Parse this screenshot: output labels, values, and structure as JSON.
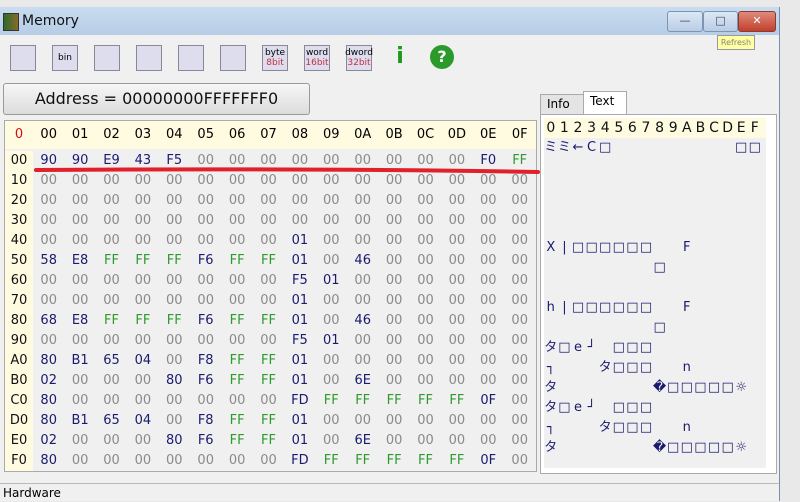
{
  "window": {
    "title": "Memory",
    "minimize": "—",
    "maximize": "□",
    "close": "✕",
    "tooltip": "Refresh"
  },
  "toolbar": [
    {
      "name": "save-icon",
      "label": ""
    },
    {
      "name": "save-bin-icon",
      "label": "bin"
    },
    {
      "name": "load-icon",
      "label": ""
    },
    {
      "name": "load-alt-icon",
      "label": ""
    },
    {
      "name": "find-binoculars-icon",
      "label": ""
    },
    {
      "name": "windows-icon",
      "label": ""
    },
    {
      "name": "byte-8bit-icon",
      "label": "byte",
      "sub": "8bit"
    },
    {
      "name": "word-16bit-icon",
      "label": "word",
      "sub": "16bit"
    },
    {
      "name": "dword-32bit-icon",
      "label": "dword",
      "sub": "32bit"
    },
    {
      "name": "info-icon",
      "label": "i"
    },
    {
      "name": "help-icon",
      "label": "?"
    }
  ],
  "address_button": "Address = 00000000FFFFFFF0",
  "hex": {
    "corner": "0",
    "columns": [
      "00",
      "01",
      "02",
      "03",
      "04",
      "05",
      "06",
      "07",
      "08",
      "09",
      "0A",
      "0B",
      "0C",
      "0D",
      "0E",
      "0F"
    ],
    "rows": [
      {
        "addr": "00",
        "bytes": [
          "90",
          "90",
          "E9",
          "43",
          "F5",
          "00",
          "00",
          "00",
          "00",
          "00",
          "00",
          "00",
          "00",
          "00",
          "F0",
          "FF"
        ]
      },
      {
        "addr": "10",
        "bytes": [
          "00",
          "00",
          "00",
          "00",
          "00",
          "00",
          "00",
          "00",
          "00",
          "00",
          "00",
          "00",
          "00",
          "00",
          "00",
          "00"
        ]
      },
      {
        "addr": "20",
        "bytes": [
          "00",
          "00",
          "00",
          "00",
          "00",
          "00",
          "00",
          "00",
          "00",
          "00",
          "00",
          "00",
          "00",
          "00",
          "00",
          "00"
        ]
      },
      {
        "addr": "30",
        "bytes": [
          "00",
          "00",
          "00",
          "00",
          "00",
          "00",
          "00",
          "00",
          "00",
          "00",
          "00",
          "00",
          "00",
          "00",
          "00",
          "00"
        ]
      },
      {
        "addr": "40",
        "bytes": [
          "00",
          "00",
          "00",
          "00",
          "00",
          "00",
          "00",
          "00",
          "01",
          "00",
          "00",
          "00",
          "00",
          "00",
          "00",
          "00"
        ]
      },
      {
        "addr": "50",
        "bytes": [
          "58",
          "E8",
          "FF",
          "FF",
          "FF",
          "F6",
          "FF",
          "FF",
          "01",
          "00",
          "46",
          "00",
          "00",
          "00",
          "00",
          "00"
        ]
      },
      {
        "addr": "60",
        "bytes": [
          "00",
          "00",
          "00",
          "00",
          "00",
          "00",
          "00",
          "00",
          "F5",
          "01",
          "00",
          "00",
          "00",
          "00",
          "00",
          "00"
        ]
      },
      {
        "addr": "70",
        "bytes": [
          "00",
          "00",
          "00",
          "00",
          "00",
          "00",
          "00",
          "00",
          "01",
          "00",
          "00",
          "00",
          "00",
          "00",
          "00",
          "00"
        ]
      },
      {
        "addr": "80",
        "bytes": [
          "68",
          "E8",
          "FF",
          "FF",
          "FF",
          "F6",
          "FF",
          "FF",
          "01",
          "00",
          "46",
          "00",
          "00",
          "00",
          "00",
          "00"
        ]
      },
      {
        "addr": "90",
        "bytes": [
          "00",
          "00",
          "00",
          "00",
          "00",
          "00",
          "00",
          "00",
          "F5",
          "01",
          "00",
          "00",
          "00",
          "00",
          "00",
          "00"
        ]
      },
      {
        "addr": "A0",
        "bytes": [
          "80",
          "B1",
          "65",
          "04",
          "00",
          "F8",
          "FF",
          "FF",
          "01",
          "00",
          "00",
          "00",
          "00",
          "00",
          "00",
          "00"
        ]
      },
      {
        "addr": "B0",
        "bytes": [
          "02",
          "00",
          "00",
          "00",
          "80",
          "F6",
          "FF",
          "FF",
          "01",
          "00",
          "6E",
          "00",
          "00",
          "00",
          "00",
          "00"
        ]
      },
      {
        "addr": "C0",
        "bytes": [
          "80",
          "00",
          "00",
          "00",
          "00",
          "00",
          "00",
          "00",
          "FD",
          "FF",
          "FF",
          "FF",
          "FF",
          "FF",
          "0F",
          "00"
        ]
      },
      {
        "addr": "D0",
        "bytes": [
          "80",
          "B1",
          "65",
          "04",
          "00",
          "F8",
          "FF",
          "FF",
          "01",
          "00",
          "00",
          "00",
          "00",
          "00",
          "00",
          "00"
        ]
      },
      {
        "addr": "E0",
        "bytes": [
          "02",
          "00",
          "00",
          "00",
          "80",
          "F6",
          "FF",
          "FF",
          "01",
          "00",
          "6E",
          "00",
          "00",
          "00",
          "00",
          "00"
        ]
      },
      {
        "addr": "F0",
        "bytes": [
          "80",
          "00",
          "00",
          "00",
          "00",
          "00",
          "00",
          "00",
          "FD",
          "FF",
          "FF",
          "FF",
          "FF",
          "FF",
          "0F",
          "00"
        ]
      }
    ]
  },
  "colors": {
    "zero": "#8a8a8a",
    "ff": "#2e9a2e",
    "value": "#1a1a6e",
    "corner": "#d01010",
    "annotation": "#e0202a"
  },
  "tabs": [
    {
      "label": "Info"
    },
    {
      "label": "Text"
    }
  ],
  "text_panel": {
    "header": [
      "0",
      "1",
      "2",
      "3",
      "4",
      "5",
      "6",
      "7",
      "8",
      "9",
      "A",
      "B",
      "C",
      "D",
      "E",
      "F"
    ],
    "rows": [
      [
        "ミ",
        "ミ",
        "←",
        "C",
        "□",
        "",
        "",
        "",
        "",
        "",
        "",
        "",
        "",
        "",
        "□",
        "□"
      ],
      [
        "",
        "",
        "",
        "",
        "",
        "",
        "",
        "",
        "",
        "",
        "",
        "",
        "",
        "",
        "",
        ""
      ],
      [
        "",
        "",
        "",
        "",
        "",
        "",
        "",
        "",
        "",
        "",
        "",
        "",
        "",
        "",
        "",
        ""
      ],
      [
        "",
        "",
        "",
        "",
        "",
        "",
        "",
        "",
        "",
        "",
        "",
        "",
        "",
        "",
        "",
        ""
      ],
      [
        "",
        "",
        "",
        "",
        "",
        "",
        "",
        "",
        "",
        "",
        "",
        "",
        "",
        "",
        "",
        ""
      ],
      [
        "X",
        "|",
        "□",
        "□",
        "□",
        "□",
        "□",
        "□",
        "",
        "",
        "F",
        "",
        "",
        "",
        "",
        ""
      ],
      [
        "",
        "",
        "",
        "",
        "",
        "",
        "",
        "",
        "□",
        "",
        "",
        "",
        "",
        "",
        "",
        ""
      ],
      [
        "",
        "",
        "",
        "",
        "",
        "",
        "",
        "",
        "",
        "",
        "",
        "",
        "",
        "",
        "",
        ""
      ],
      [
        "h",
        "|",
        "□",
        "□",
        "□",
        "□",
        "□",
        "□",
        "",
        "",
        "F",
        "",
        "",
        "",
        "",
        ""
      ],
      [
        "",
        "",
        "",
        "",
        "",
        "",
        "",
        "",
        "□",
        "",
        "",
        "",
        "",
        "",
        "",
        ""
      ],
      [
        "タ",
        "□",
        "e",
        "┘",
        "",
        "□",
        "□",
        "□",
        "",
        "",
        "",
        "",
        "",
        "",
        "",
        ""
      ],
      [
        "┐",
        "",
        "",
        "",
        "タ",
        "□",
        "□",
        "□",
        "",
        "",
        "n",
        "",
        "",
        "",
        "",
        ""
      ],
      [
        "タ",
        "",
        "",
        "",
        "",
        "",
        "",
        "",
        "�",
        "□",
        "□",
        "□",
        "□",
        "□",
        "☼",
        ""
      ],
      [
        "タ",
        "□",
        "e",
        "┘",
        "",
        "□",
        "□",
        "□",
        "",
        "",
        "",
        "",
        "",
        "",
        "",
        ""
      ],
      [
        "┐",
        "",
        "",
        "",
        "タ",
        "□",
        "□",
        "□",
        "",
        "",
        "n",
        "",
        "",
        "",
        "",
        ""
      ],
      [
        "タ",
        "",
        "",
        "",
        "",
        "",
        "",
        "",
        "�",
        "□",
        "□",
        "□",
        "□",
        "□",
        "☼",
        ""
      ]
    ]
  },
  "status": "Hardware"
}
